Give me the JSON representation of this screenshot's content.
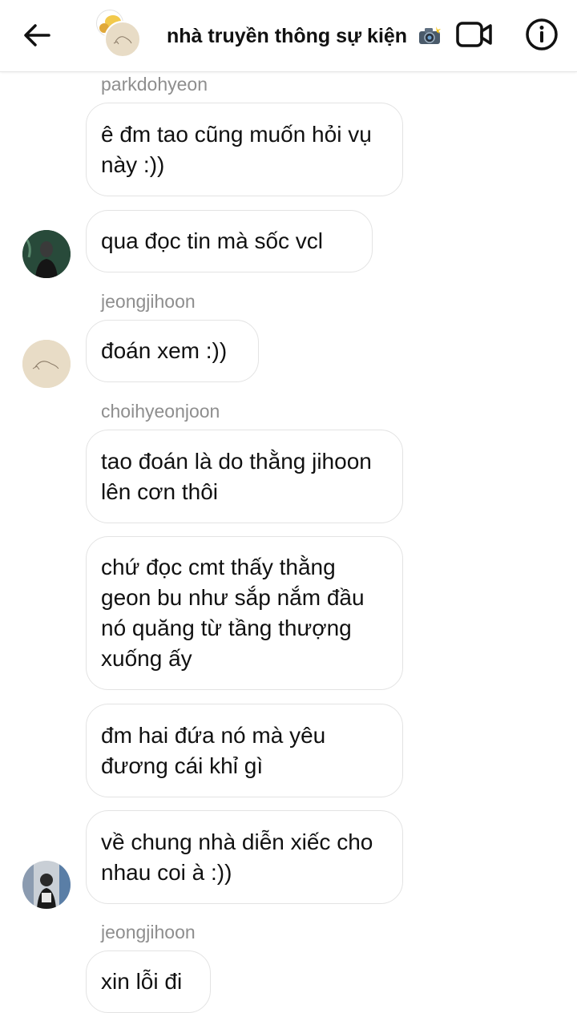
{
  "header": {
    "title": "nhà truyền thông sự kiện",
    "title_emoji": "camera-flash-emoji",
    "back_icon": "arrow-left-icon",
    "video_icon": "video-camera-icon",
    "info_icon": "info-icon"
  },
  "messages": [
    {
      "sender": "parkdohyeon",
      "text": "ê đm tao cũng muốn hỏi vụ này :))"
    },
    {
      "sender": "",
      "text": "qua đọc tin mà sốc vcl"
    },
    {
      "sender": "jeongjihoon",
      "text": "đoán xem :))"
    },
    {
      "sender": "choihyeonjoon",
      "text": "tao đoán là do thằng jihoon lên cơn thôi"
    },
    {
      "sender": "",
      "text": "chứ đọc cmt thấy thằng geon bu như sắp nắm đầu nó quăng từ tầng thượng xuống ấy"
    },
    {
      "sender": "",
      "text": "đm hai đứa nó mà yêu đương cái khỉ gì"
    },
    {
      "sender": "",
      "text": "về chung nhà diễn xiếc cho nhau coi à :))"
    },
    {
      "sender": "jeongjihoon",
      "text": "xin lỗi đi"
    }
  ]
}
